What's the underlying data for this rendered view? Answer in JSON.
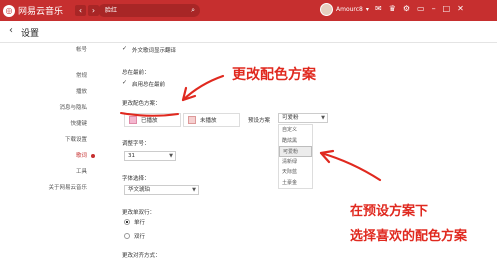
{
  "app": {
    "logo_glyph": "◎",
    "name": "网易云音乐",
    "search_value": "脸红",
    "username": "Amourc8",
    "icons": [
      "back-arrow-icon",
      "forward-arrow-icon",
      "search-icon",
      "mail-icon",
      "skin-icon",
      "settings-icon",
      "mini-mode-icon",
      "minimize-icon",
      "maximize-icon",
      "close-icon"
    ]
  },
  "page": {
    "back_glyph": "‹",
    "title": "设置"
  },
  "sidebar": {
    "items": [
      "帐号",
      "常规",
      "播放",
      "消息与隐私",
      "快捷键",
      "下载设置",
      "歌词",
      "工具",
      "关于网易云音乐"
    ],
    "active_index": 6
  },
  "settings": {
    "translate_label": "外文歌词显示翻译",
    "always_top_heading": "总在最前：",
    "always_top_option": "启用总在最前",
    "color_scheme_heading": "更改配色方案：",
    "played_label": "已播放",
    "unplayed_label": "未播放",
    "preset_label": "预设方案",
    "preset_selected": "可爱粉",
    "preset_options": [
      "自定义",
      "酷炫黑",
      "可爱粉",
      "清新绿",
      "天际蓝",
      "土豪金"
    ],
    "font_size_heading": "调整字号：",
    "font_size_value": "31",
    "font_heading": "字体选择：",
    "font_value": "华文琥珀",
    "line_mode_heading": "更改单双行：",
    "line_single": "单行",
    "line_double": "双行",
    "align_heading": "更改对齐方式："
  },
  "annotations": {
    "top": "更改配色方案",
    "bottom_line1": "在预设方案下",
    "bottom_line2": "选择喜欢的配色方案"
  },
  "colors": {
    "brand": "#c62f2f",
    "annotation_red": "#e0291f",
    "pink_swatch": "#f4b7cf"
  }
}
